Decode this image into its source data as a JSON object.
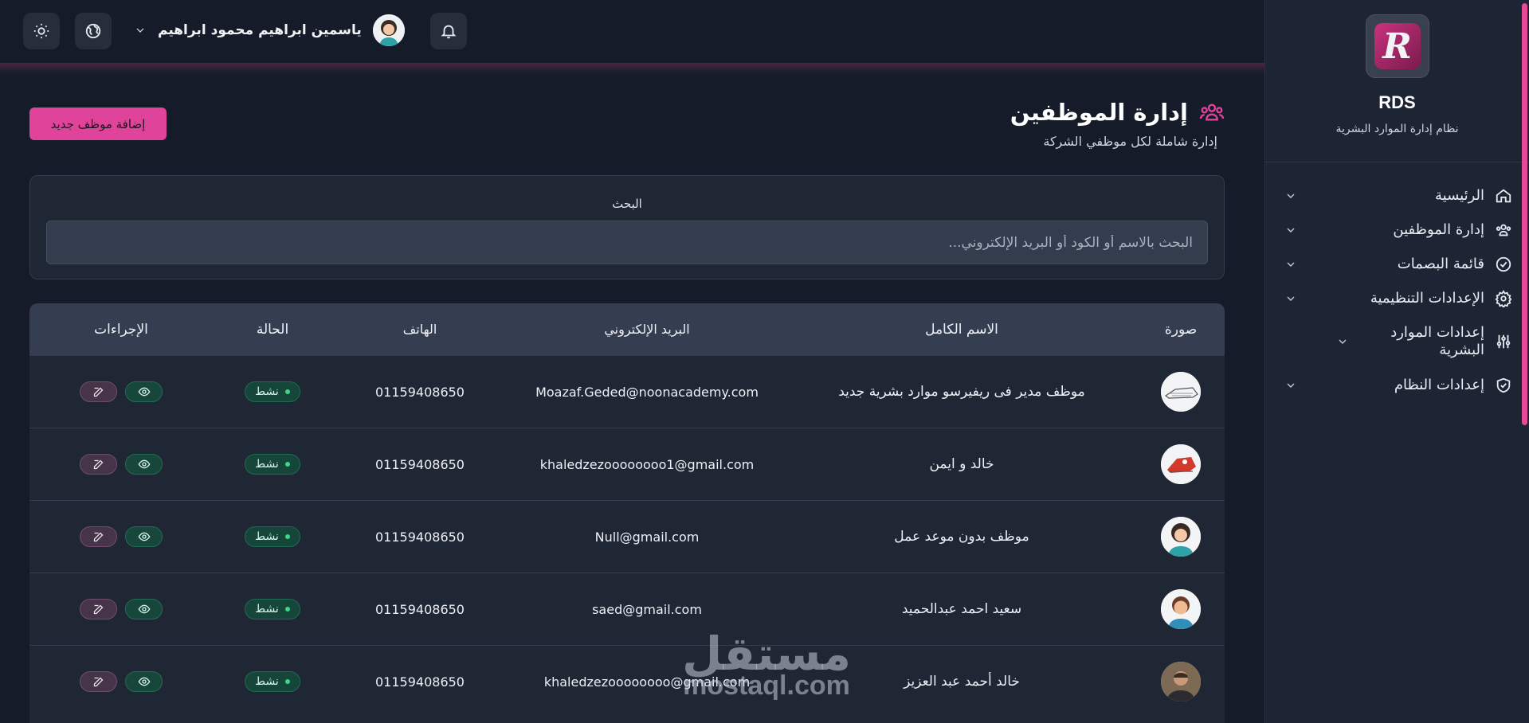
{
  "header": {
    "user_name": "ياسمين ابراهيم محمود ابراهيم"
  },
  "sidebar": {
    "brand_title": "RDS",
    "brand_subtitle": "نظام إدارة الموارد البشرية",
    "items": [
      {
        "label": "الرئيسية",
        "icon": "home-icon"
      },
      {
        "label": "إدارة الموظفين",
        "icon": "users-icon"
      },
      {
        "label": "قائمة البصمات",
        "icon": "check-circle-icon"
      },
      {
        "label": "الإعدادات التنظيمية",
        "icon": "gear-icon"
      },
      {
        "label": "إعدادات الموارد البشرية",
        "icon": "sliders-icon"
      },
      {
        "label": "إعدادات النظام",
        "icon": "shield-check-icon"
      }
    ]
  },
  "page": {
    "title": "إدارة الموظفين",
    "subtitle": "إدارة شاملة لكل موظفي الشركة",
    "add_button": "إضافة موظف جديد"
  },
  "search": {
    "label": "البحث",
    "placeholder": "البحث بالاسم أو الكود أو البريد الإلكتروني...",
    "value": ""
  },
  "table": {
    "columns": [
      "صورة",
      "الاسم الكامل",
      "البريد الإلكتروني",
      "الهاتف",
      "الحالة",
      "الإجراءات"
    ],
    "rows": [
      {
        "name": "موظف مدير فى ريفيرسو موارد بشرية جديد",
        "email": "Moazaf.Geded@noonacademy.com",
        "phone": "01159408650",
        "status": "نشط"
      },
      {
        "name": "خالد و ايمن",
        "email": "khaledzezoooooooo1@gmail.com",
        "phone": "01159408650",
        "status": "نشط"
      },
      {
        "name": "موظف بدون موعد عمل",
        "email": "Null@gmail.com",
        "phone": "01159408650",
        "status": "نشط"
      },
      {
        "name": "سعيد احمد عبدالحميد",
        "email": "saed@gmail.com",
        "phone": "01159408650",
        "status": "نشط"
      },
      {
        "name": "خالد أحمد عبد العزيز",
        "email": "khaledzezoooooooo@gmail.com",
        "phone": "01159408650",
        "status": "نشط"
      }
    ]
  },
  "watermark": {
    "arabic": "مستقل",
    "latin": "mostaql.com"
  },
  "colors": {
    "accent": "#e0449a",
    "background": "#151b29",
    "panel": "#1f2634",
    "status_green": "#3fd48a"
  }
}
